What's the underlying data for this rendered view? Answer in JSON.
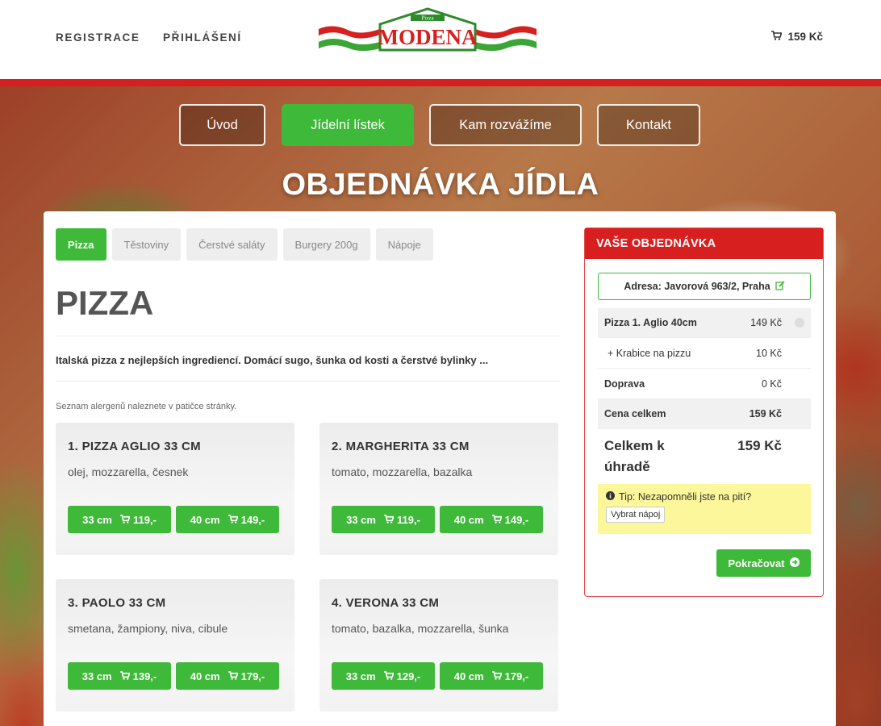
{
  "header": {
    "register": "REGISTRACE",
    "login": "PŘIHLÁŠENÍ",
    "logo_small": "Pizza",
    "logo_text": "MODENA",
    "cart_total": "159 Kč"
  },
  "nav": [
    {
      "label": "Úvod"
    },
    {
      "label": "Jídelní lístek"
    },
    {
      "label": "Kam rozvážíme"
    },
    {
      "label": "Kontakt"
    }
  ],
  "page_title": "OBJEDNÁVKA JÍDLA",
  "tabs": [
    "Pizza",
    "Těstoviny",
    "Čerstvé saláty",
    "Burgery 200g",
    "Nápoje"
  ],
  "category": {
    "title": "PIZZA",
    "description": "Italská pizza z nejlepších ingrediencí. Domácí sugo, šunka od kosti a čerstvé bylinky ...",
    "allergen_note": "Seznam alergenů naleznete v patičce stránky."
  },
  "products": [
    {
      "name": "1. PIZZA AGLIO 33 CM",
      "ingredients": "olej, mozzarella, česnek",
      "size1": "33 cm",
      "price1": "119,-",
      "size2": "40 cm",
      "price2": "149,-"
    },
    {
      "name": "2. MARGHERITA 33 CM",
      "ingredients": "tomato, mozzarella, bazalka",
      "size1": "33 cm",
      "price1": "119,-",
      "size2": "40 cm",
      "price2": "149,-"
    },
    {
      "name": "3. PAOLO 33 CM",
      "ingredients": "smetana, žampiony, niva, cibule",
      "size1": "33 cm",
      "price1": "139,-",
      "size2": "40 cm",
      "price2": "179,-"
    },
    {
      "name": "4. VERONA 33 CM",
      "ingredients": "tomato, bazalka, mozzarella, šunka",
      "size1": "33 cm",
      "price1": "129,-",
      "size2": "40 cm",
      "price2": "179,-"
    }
  ],
  "order": {
    "title": "VAŠE OBJEDNÁVKA",
    "address": "Adresa: Javorová 963/2, Praha",
    "items": [
      {
        "label": "Pizza 1. Aglio 40cm",
        "price": "149 Kč"
      },
      {
        "label": "+ Krabice na pizzu",
        "price": "10 Kč"
      },
      {
        "label": "Doprava",
        "price": "0 Kč"
      },
      {
        "label": "Cena celkem",
        "price": "159 Kč"
      }
    ],
    "total_label": "Celkem k úhradě",
    "total_value": "159 Kč",
    "tip": "Tip: Nezapomněli jste na pití?",
    "tip_button": "Vybrat nápoj",
    "continue": "Pokračovat"
  },
  "colors": {
    "brand_red": "#d81f1f",
    "green": "#3fb93a",
    "tip_yellow": "#fbf79a"
  },
  "icons": [
    "cart-icon",
    "edit-icon",
    "remove-icon",
    "info-icon",
    "arrow-right-circle-icon"
  ]
}
